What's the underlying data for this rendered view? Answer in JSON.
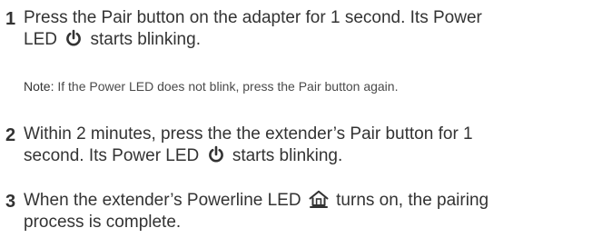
{
  "steps": [
    {
      "number": "1",
      "line1": "Press the Pair button on the adapter for 1 second. Its Power",
      "line2_before_icon": "LED",
      "line2_after_icon": "starts blinking.",
      "icon": "power-icon"
    },
    {
      "note_label": "Note:",
      "note_text": "If the Power LED does not blink, press the Pair button again."
    },
    {
      "number": "2",
      "line1": "Within 2 minutes, press the the extender’s Pair button for 1",
      "line2_before_icon": "second. Its Power LED",
      "line2_after_icon": "starts blinking.",
      "icon": "power-icon"
    },
    {
      "number": "3",
      "line1_before_icon": "When the extender’s Powerline LED",
      "line1_after_icon": "turns on, the pairing",
      "line2": "process is complete.",
      "icon": "powerline-house-icon"
    }
  ]
}
